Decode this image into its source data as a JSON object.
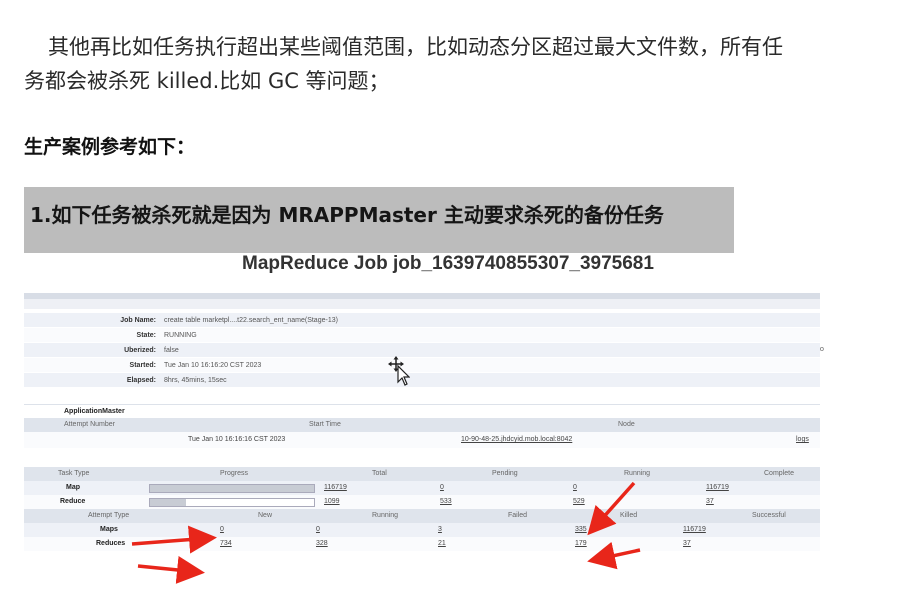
{
  "article": {
    "paragraph_line1": "其他再比如任务执行超出某些阈值范围，比如动态分区超过最大文件数，所有任",
    "paragraph_line2": "务都会被杀死 killed.比如 GC 等问题；",
    "heading": "生产案例参考如下：",
    "banner_heading": "1.如下任务被杀死就是因为 MRAPPMaster 主动要求杀死的备份任务"
  },
  "screenshot": {
    "job_title": "MapReduce Job job_1639740855307_3975681",
    "corner_label": "Jo",
    "job_info": [
      {
        "label": "Job Name:",
        "value": "create table marketpl....t22.search_ent_name(Stage-13)"
      },
      {
        "label": "State:",
        "value": "RUNNING"
      },
      {
        "label": "Uberized:",
        "value": "false"
      },
      {
        "label": "Started:",
        "value": "Tue Jan 10 16:16:20 CST 2023"
      },
      {
        "label": "Elapsed:",
        "value": "8hrs, 45mins, 15sec"
      }
    ],
    "application_master": {
      "title": "ApplicationMaster",
      "columns": [
        "Attempt Number",
        "Start Time",
        "Node"
      ],
      "row": {
        "start_time": "Tue Jan 10 16:16:16 CST 2023",
        "node": "10-90-48-25.jhdcyid.mob.local:8042",
        "logs": "logs"
      }
    },
    "task_table": {
      "columns": [
        "Task Type",
        "Progress",
        "Total",
        "Pending",
        "Running",
        "Complete"
      ],
      "rows": [
        {
          "type": "Map",
          "progress": 1.0,
          "total": "116719",
          "pending": "0",
          "running": "0",
          "complete": "116719"
        },
        {
          "type": "Reduce",
          "progress": 0.22,
          "total": "1099",
          "pending": "533",
          "running": "529",
          "complete": "37"
        }
      ]
    },
    "attempt_table": {
      "columns": [
        "Attempt Type",
        "New",
        "Running",
        "Failed",
        "Killed",
        "Successful"
      ],
      "rows": [
        {
          "type": "Maps",
          "new": "0",
          "running": "0",
          "failed": "3",
          "killed": "335",
          "successful": "116719"
        },
        {
          "type": "Reduces",
          "new": "734",
          "running": "328",
          "failed": "21",
          "killed": "179",
          "successful": "37"
        }
      ]
    },
    "annotation_color": "#e8261a"
  }
}
